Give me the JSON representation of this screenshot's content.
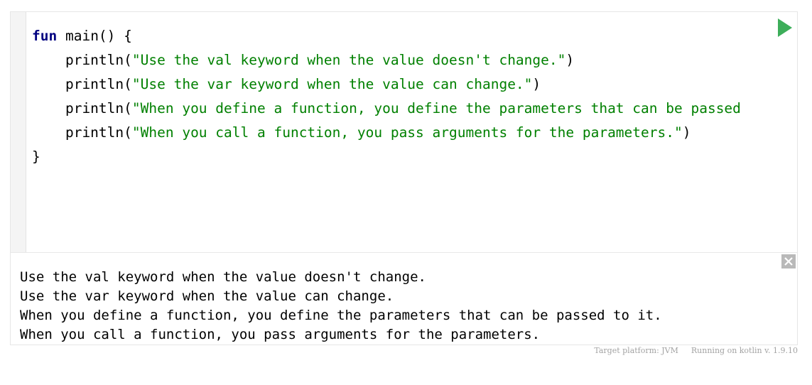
{
  "editor": {
    "lines": [
      [
        {
          "t": "fun",
          "c": "kw"
        },
        {
          "t": " main() {",
          "c": ""
        }
      ],
      [
        {
          "t": "    println(",
          "c": ""
        },
        {
          "t": "\"Use the val keyword when the value doesn't change.\"",
          "c": "str"
        },
        {
          "t": ")",
          "c": ""
        }
      ],
      [
        {
          "t": "    println(",
          "c": ""
        },
        {
          "t": "\"Use the var keyword when the value can change.\"",
          "c": "str"
        },
        {
          "t": ")",
          "c": ""
        }
      ],
      [
        {
          "t": "    println(",
          "c": ""
        },
        {
          "t": "\"When you define a function, you define the parameters that can be passed",
          "c": "str"
        }
      ],
      [
        {
          "t": "    println(",
          "c": ""
        },
        {
          "t": "\"When you call a function, you pass arguments for the parameters.\"",
          "c": "str"
        },
        {
          "t": ")",
          "c": ""
        }
      ],
      [
        {
          "t": "}",
          "c": ""
        }
      ]
    ],
    "run_icon": "play-icon",
    "run_color": "#3dae5a"
  },
  "output": {
    "lines": [
      "Use the val keyword when the value doesn't change.",
      "Use the var keyword when the value can change.",
      "When you define a function, you define the parameters that can be passed to it.",
      "When you call a function, you pass arguments for the parameters."
    ],
    "close_icon": "close-icon"
  },
  "footer": {
    "target_platform": "Target platform: JVM",
    "running_on": "Running on kotlin v. 1.9.10"
  }
}
